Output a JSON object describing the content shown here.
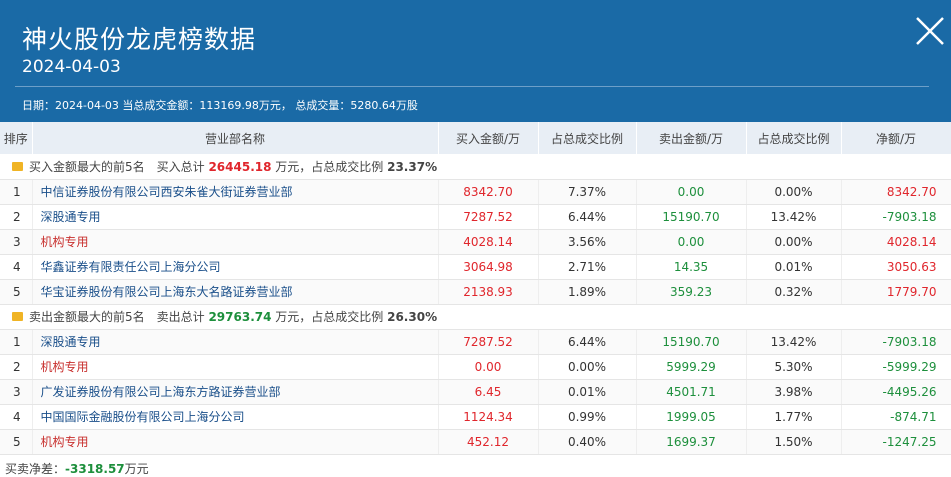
{
  "header": {
    "title": "神火股份龙虎榜数据",
    "date": "2024-04-03",
    "summary": "日期：2024-04-03 当总成交金额：113169.98万元， 总成交量：5280.64万股"
  },
  "columns": [
    "排序",
    "营业部名称",
    "买入金额/万",
    "占总成交比例",
    "卖出金额/万",
    "占总成交比例",
    "净额/万"
  ],
  "buy_group": {
    "prefix": "买入金额最大的前5名　买入总计 ",
    "total": "26445.18",
    "mid": " 万元，占总成交比例 ",
    "ratio": "23.37%",
    "rows": [
      {
        "rank": "1",
        "name": "中信证券股份有限公司西安朱雀大街证券营业部",
        "buy": "8342.70",
        "buy_ratio": "7.37%",
        "sell": "0.00",
        "sell_ratio": "0.00%",
        "net": "8342.70"
      },
      {
        "rank": "2",
        "name": "深股通专用",
        "buy": "7287.52",
        "buy_ratio": "6.44%",
        "sell": "15190.70",
        "sell_ratio": "13.42%",
        "net": "-7903.18"
      },
      {
        "rank": "3",
        "name": "机构专用",
        "buy": "4028.14",
        "buy_ratio": "3.56%",
        "sell": "0.00",
        "sell_ratio": "0.00%",
        "net": "4028.14"
      },
      {
        "rank": "4",
        "name": "华鑫证券有限责任公司上海分公司",
        "buy": "3064.98",
        "buy_ratio": "2.71%",
        "sell": "14.35",
        "sell_ratio": "0.01%",
        "net": "3050.63"
      },
      {
        "rank": "5",
        "name": "华宝证券股份有限公司上海东大名路证券营业部",
        "buy": "2138.93",
        "buy_ratio": "1.89%",
        "sell": "359.23",
        "sell_ratio": "0.32%",
        "net": "1779.70"
      }
    ]
  },
  "sell_group": {
    "prefix": "卖出金额最大的前5名　卖出总计 ",
    "total": "29763.74",
    "mid": " 万元，占总成交比例 ",
    "ratio": "26.30%",
    "rows": [
      {
        "rank": "1",
        "name": "深股通专用",
        "buy": "7287.52",
        "buy_ratio": "6.44%",
        "sell": "15190.70",
        "sell_ratio": "13.42%",
        "net": "-7903.18"
      },
      {
        "rank": "2",
        "name": "机构专用",
        "buy": "0.00",
        "buy_ratio": "0.00%",
        "sell": "5999.29",
        "sell_ratio": "5.30%",
        "net": "-5999.29"
      },
      {
        "rank": "3",
        "name": "广发证券股份有限公司上海东方路证券营业部",
        "buy": "6.45",
        "buy_ratio": "0.01%",
        "sell": "4501.71",
        "sell_ratio": "3.98%",
        "net": "-4495.26"
      },
      {
        "rank": "4",
        "name": "中国国际金融股份有限公司上海分公司",
        "buy": "1124.34",
        "buy_ratio": "0.99%",
        "sell": "1999.05",
        "sell_ratio": "1.77%",
        "net": "-874.71"
      },
      {
        "rank": "5",
        "name": "机构专用",
        "buy": "452.12",
        "buy_ratio": "0.40%",
        "sell": "1699.37",
        "sell_ratio": "1.50%",
        "net": "-1247.25"
      }
    ]
  },
  "footer": {
    "label": "买卖净差：",
    "value": "-3318.57",
    "unit": "万元"
  },
  "colors": {
    "header_bg": "#1a6aa6",
    "buy": "#e0262c",
    "sell": "#1d8f3c",
    "link": "#1a4f8a"
  },
  "icons": {
    "close": "close-icon",
    "group": "folder-icon"
  }
}
